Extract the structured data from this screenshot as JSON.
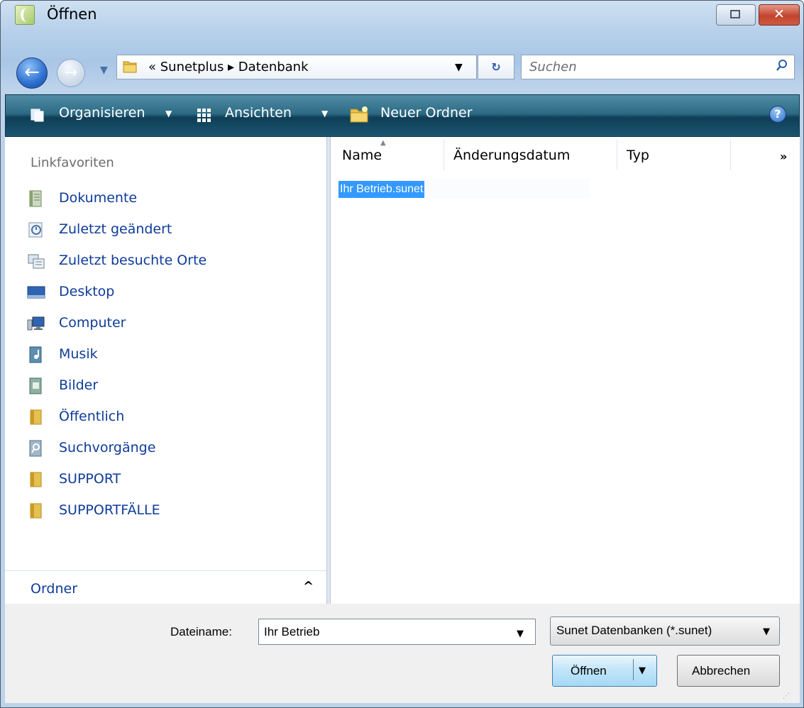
{
  "window": {
    "title": "Öffnen",
    "restore_glyph": "⧉",
    "close_glyph": "✕"
  },
  "navigation": {
    "address_path": "« Sunetplus ▸ Datenbank",
    "search_placeholder": "Suchen"
  },
  "toolbar": {
    "organize_label": "Organisieren",
    "views_label": "Ansichten",
    "new_folder_label": "Neuer Ordner",
    "help_glyph": "?"
  },
  "sidebar": {
    "heading": "Linkfavoriten",
    "items": [
      {
        "label": "Dokumente",
        "icon": "documents-icon"
      },
      {
        "label": "Zuletzt geändert",
        "icon": "recent-changed-icon"
      },
      {
        "label": "Zuletzt besuchte Orte",
        "icon": "recent-places-icon"
      },
      {
        "label": "Desktop",
        "icon": "desktop-icon"
      },
      {
        "label": "Computer",
        "icon": "computer-icon"
      },
      {
        "label": "Musik",
        "icon": "music-icon"
      },
      {
        "label": "Bilder",
        "icon": "pictures-icon"
      },
      {
        "label": "Öffentlich",
        "icon": "folder-icon"
      },
      {
        "label": "Suchvorgänge",
        "icon": "searches-icon"
      },
      {
        "label": "SUPPORT",
        "icon": "folder-icon"
      },
      {
        "label": "SUPPORTFÄLLE",
        "icon": "folder-icon"
      }
    ],
    "folders_label": "Ordner"
  },
  "file_list": {
    "columns": [
      "Name",
      "Änderungsdatum",
      "Typ"
    ],
    "more_columns": "»",
    "files": [
      {
        "name": "Ihr Betrieb.sunet",
        "selected": true
      }
    ]
  },
  "bottom": {
    "filename_label": "Dateiname:",
    "filename_value": "Ihr Betrieb",
    "filter_value": "Sunet Datenbanken (*.sunet)",
    "open_label": "Öffnen",
    "cancel_label": "Abbrechen"
  },
  "colors": {
    "toolbar": "#1a5670",
    "link_text": "#0e3b9a",
    "selection": "#3399ff",
    "close_button": "#c2442e"
  }
}
